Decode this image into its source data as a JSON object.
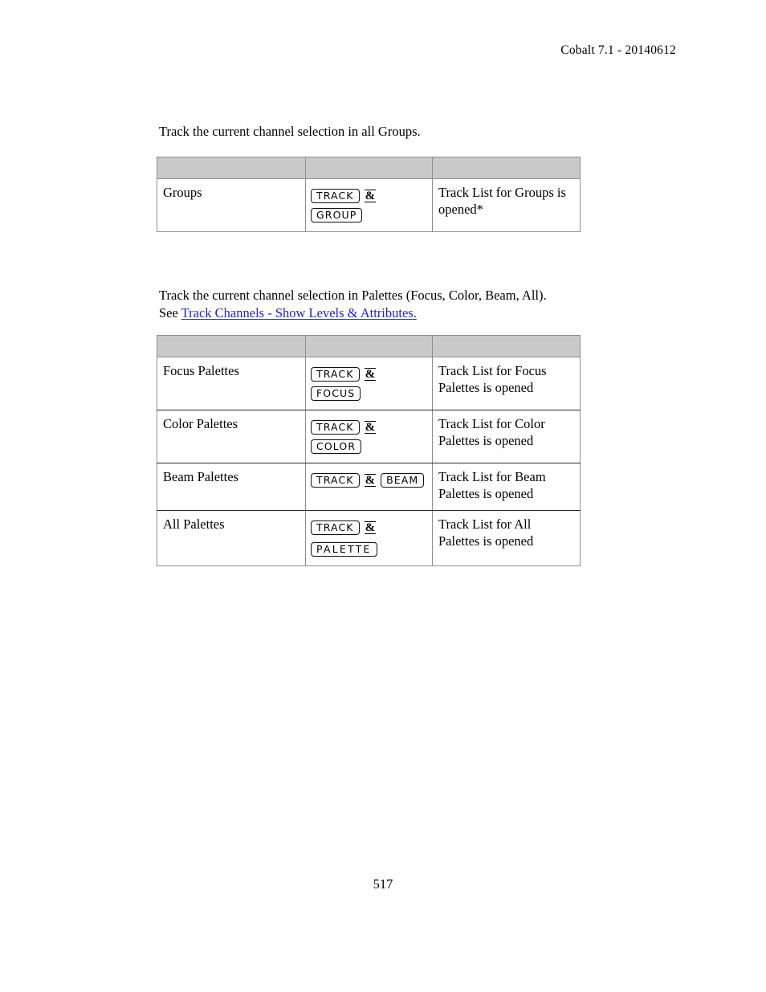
{
  "document": {
    "header": "Cobalt 7.1 - 20140612",
    "page_number": "517",
    "link_color": "#2222cc",
    "header_fill_color": "#c9c9c9",
    "border_color": "#8e8e8e"
  },
  "sections": [
    {
      "intro": "Track the current channel selection in all Groups.",
      "table": {
        "headers": [
          "",
          "",
          ""
        ],
        "rows": [
          {
            "label": "Groups",
            "keys": [
              {
                "type": "keycap",
                "text": "TRACK"
              },
              {
                "type": "amp",
                "text": "&"
              },
              {
                "type": "keycap",
                "text": "GROUP"
              }
            ],
            "result": "Track List for Groups is opened*"
          }
        ]
      }
    },
    {
      "intro_line_1": "Track the current channel selection in Palettes (Focus, Color, Beam, All).",
      "intro_line_2_prefix": "See ",
      "intro_link": "Track Channels - Show Levels & Attributes.",
      "table": {
        "headers": [
          "",
          "",
          ""
        ],
        "rows": [
          {
            "label": "Focus Palettes",
            "keys": [
              {
                "type": "keycap",
                "text": "TRACK"
              },
              {
                "type": "amp",
                "text": "&"
              },
              {
                "type": "keycap",
                "text": "FOCUS"
              }
            ],
            "result": "Track List for Focus Palettes is opened"
          },
          {
            "label": "Color Palettes",
            "keys": [
              {
                "type": "keycap",
                "text": "TRACK"
              },
              {
                "type": "amp",
                "text": "&"
              },
              {
                "type": "keycap",
                "text": "COLOR"
              }
            ],
            "result": "Track List for Color Palettes is opened"
          },
          {
            "label": "Beam Palettes",
            "keys": [
              {
                "type": "keycap",
                "text": "TRACK"
              },
              {
                "type": "amp",
                "text": "&"
              },
              {
                "type": "keycap",
                "text": "BEAM"
              }
            ],
            "result": "Track List for Beam Palettes is opened"
          },
          {
            "label": "All Palettes",
            "keys": [
              {
                "type": "keycap",
                "text": "TRACK"
              },
              {
                "type": "amp",
                "text": "&"
              },
              {
                "type": "break"
              },
              {
                "type": "keycap",
                "text": "PALETTE",
                "wide": true
              }
            ],
            "result": "Track List for All Palettes is opened"
          }
        ]
      }
    }
  ]
}
